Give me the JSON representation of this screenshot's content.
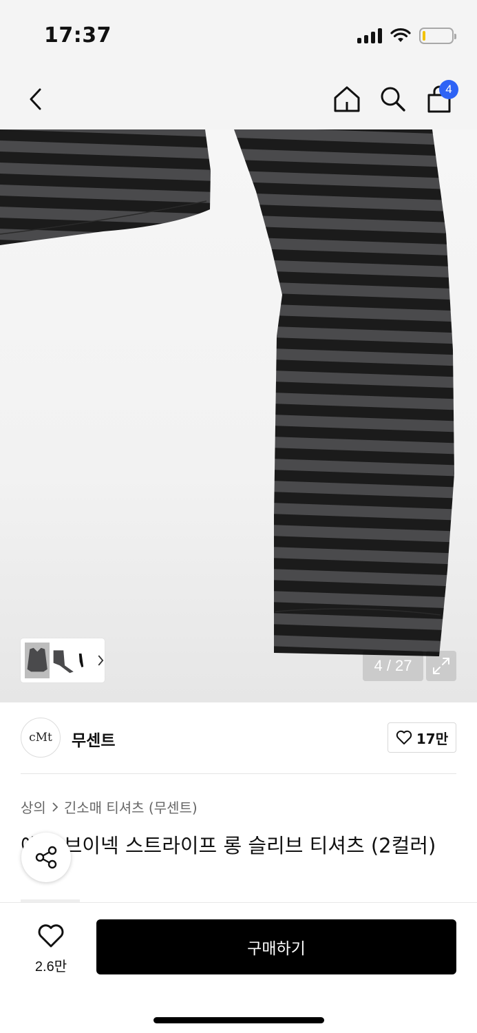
{
  "status_bar": {
    "time": "17:37",
    "battery_level": 0.1
  },
  "header": {
    "back_icon": "chevron-left-icon",
    "home_icon": "home-icon",
    "search_icon": "search-icon",
    "cart_icon": "shopping-bag-icon",
    "cart_count": "4",
    "badge_color": "#2e63f5"
  },
  "gallery": {
    "page_counter": "4 / 27",
    "current_index": 4,
    "total_images": 27,
    "thumbnail_count": 3,
    "expand_icon": "expand-icon",
    "stripe_colors": [
      "#1b1b1b",
      "#4a4a4c"
    ]
  },
  "brand": {
    "logo_text": "cMt",
    "name": "무센트",
    "like_count": "17만"
  },
  "breadcrumb": {
    "category": "상의",
    "subcategory": "긴소매 티셔츠 (무센트)"
  },
  "product": {
    "title": "에코 브이넥 스트라이프 롱 슬리브 티셔츠 (2컬러)"
  },
  "bottom_bar": {
    "wish_count": "2.6만",
    "buy_label": "구매하기"
  }
}
